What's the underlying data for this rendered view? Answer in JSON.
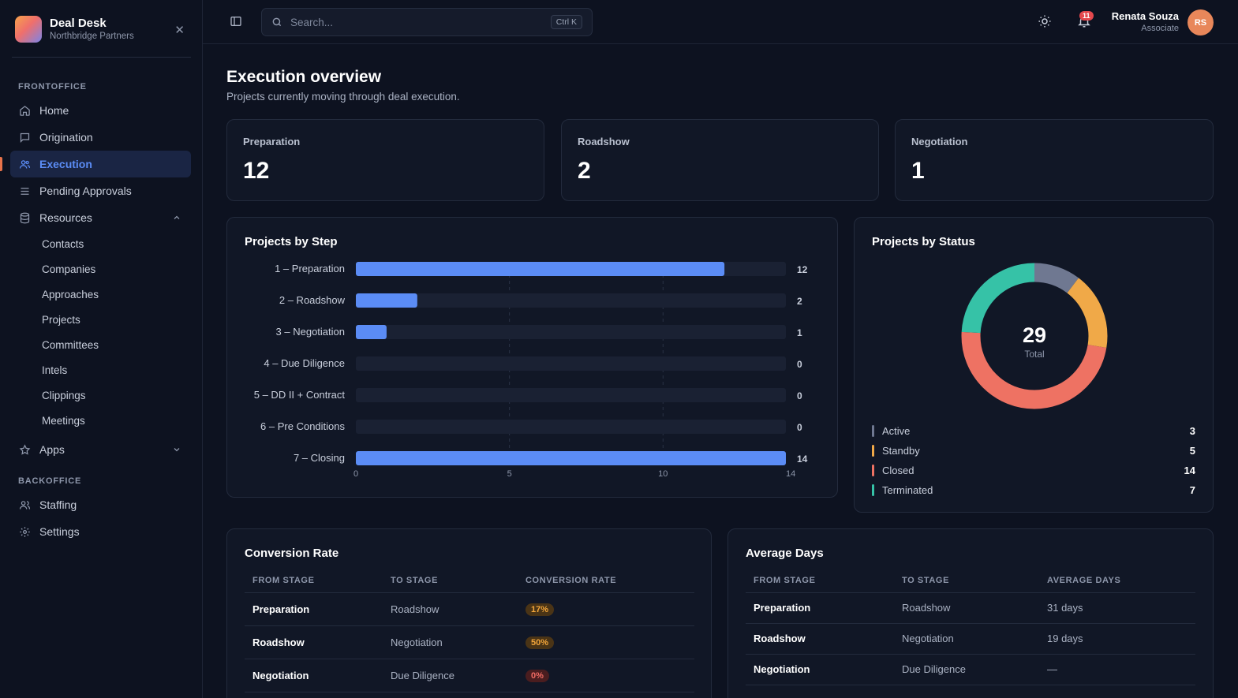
{
  "brand": {
    "title": "Deal Desk",
    "subtitle": "Northbridge Partners"
  },
  "sidebar": {
    "frontoffice_label": "FRONTOFFICE",
    "backoffice_label": "BACKOFFICE",
    "items": [
      {
        "label": "Home",
        "icon": "home-icon"
      },
      {
        "label": "Origination",
        "icon": "message-square-icon"
      },
      {
        "label": "Execution",
        "icon": "users-icon",
        "active": true
      },
      {
        "label": "Pending Approvals",
        "icon": "list-check-icon"
      },
      {
        "label": "Resources",
        "icon": "database-icon",
        "expanded": true
      },
      {
        "label": "Apps",
        "icon": "star-icon",
        "expanded": false
      }
    ],
    "resources": [
      "Contacts",
      "Companies",
      "Approaches",
      "Projects",
      "Committees",
      "Intels",
      "Clippings",
      "Meetings"
    ],
    "backoffice": [
      {
        "label": "Staffing",
        "icon": "user-group-icon"
      },
      {
        "label": "Settings",
        "icon": "gear-icon"
      }
    ]
  },
  "header": {
    "search_placeholder": "Search...",
    "shortcut": "Ctrl K",
    "notifications": "11",
    "user_name": "Renata Souza",
    "user_role": "Associate",
    "avatar_initials": "RS"
  },
  "page": {
    "title": "Execution overview",
    "subtitle": "Projects currently moving through deal execution."
  },
  "stats": [
    {
      "label": "Preparation",
      "value": "12"
    },
    {
      "label": "Roadshow",
      "value": "2"
    },
    {
      "label": "Negotiation",
      "value": "1"
    }
  ],
  "chart_data": [
    {
      "type": "bar",
      "orientation": "horizontal",
      "title": "Projects by Step",
      "categories": [
        "1 – Preparation",
        "2 – Roadshow",
        "3 – Negotiation",
        "4 – Due Diligence",
        "5 – DD II + Contract",
        "6 – Pre Conditions",
        "7 – Closing"
      ],
      "values": [
        12,
        2,
        1,
        0,
        0,
        0,
        14
      ],
      "xlim": [
        0,
        14
      ],
      "ticks": [
        "0",
        "5",
        "10",
        "14"
      ],
      "tick_values": [
        0,
        5,
        10,
        14
      ],
      "color": "#5b8cf5"
    },
    {
      "type": "pie",
      "donut": true,
      "title": "Projects by Status",
      "center_value": "29",
      "center_label": "Total",
      "categories": [
        "Active",
        "Standby",
        "Closed",
        "Terminated"
      ],
      "values": [
        3,
        5,
        14,
        7
      ],
      "colors": [
        "#6f7891",
        "#f0a948",
        "#ee7263",
        "#36c2a7"
      ]
    }
  ],
  "conversion": {
    "title": "Conversion Rate",
    "headers": [
      "FROM STAGE",
      "TO STAGE",
      "CONVERSION RATE"
    ],
    "rows": [
      {
        "from": "Preparation",
        "to": "Roadshow",
        "rate": "17%",
        "tone": "warn"
      },
      {
        "from": "Roadshow",
        "to": "Negotiation",
        "rate": "50%",
        "tone": "warn"
      },
      {
        "from": "Negotiation",
        "to": "Due Diligence",
        "rate": "0%",
        "tone": "bad"
      }
    ]
  },
  "average_days": {
    "title": "Average Days",
    "headers": [
      "FROM STAGE",
      "TO STAGE",
      "AVERAGE DAYS"
    ],
    "rows": [
      {
        "from": "Preparation",
        "to": "Roadshow",
        "days": "31 days"
      },
      {
        "from": "Roadshow",
        "to": "Negotiation",
        "days": "19 days"
      },
      {
        "from": "Negotiation",
        "to": "Due Diligence",
        "days": "—"
      }
    ]
  }
}
